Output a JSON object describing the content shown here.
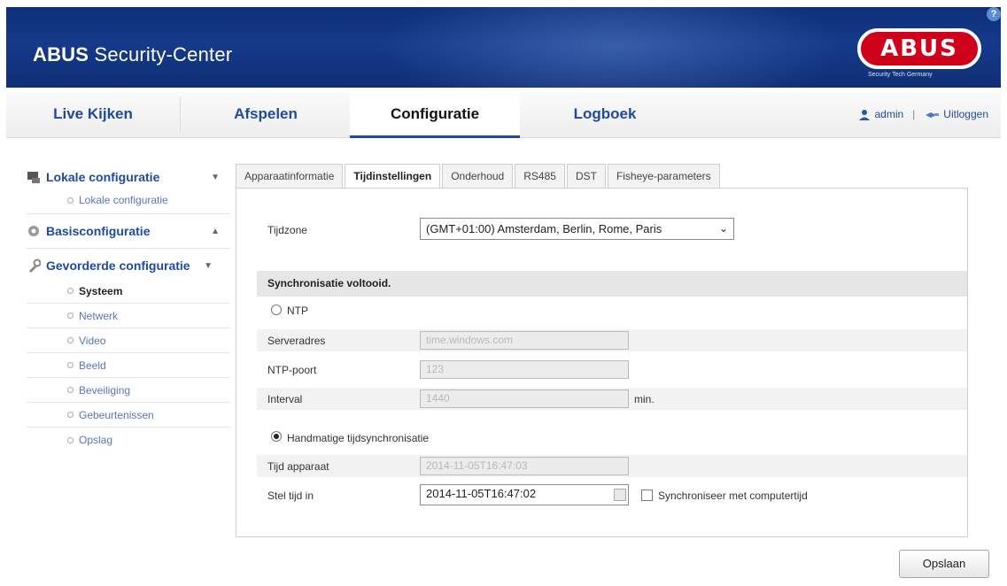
{
  "header": {
    "title_bold": "ABUS",
    "title_rest": " Security-Center",
    "logo_text": "ABUS",
    "logo_tagline": "Security Tech Germany",
    "help_label": "?"
  },
  "nav": {
    "tabs": [
      {
        "label": "Live Kijken"
      },
      {
        "label": "Afspelen"
      },
      {
        "label": "Configuratie"
      },
      {
        "label": "Logboek"
      }
    ],
    "user": "admin",
    "separator": "|",
    "logout": "Uitloggen"
  },
  "sidebar": {
    "local": {
      "label": "Lokale configuratie",
      "items": [
        "Lokale configuratie"
      ]
    },
    "basic": {
      "label": "Basisconfiguratie"
    },
    "advanced": {
      "label": "Gevorderde configuratie",
      "items": [
        "Systeem",
        "Netwerk",
        "Video",
        "Beeld",
        "Beveiliging",
        "Gebeurtenissen",
        "Opslag"
      ]
    }
  },
  "tabs": [
    "Apparaatinformatie",
    "Tijdinstellingen",
    "Onderhoud",
    "RS485",
    "DST",
    "Fisheye-parameters"
  ],
  "form": {
    "timezone_label": "Tijdzone",
    "timezone_value": "(GMT+01:00) Amsterdam, Berlin, Rome, Paris",
    "sync_status": "Synchronisatie voltooid.",
    "ntp_label": "NTP",
    "server_label": "Serveradres",
    "server_value": "time.windows.com",
    "port_label": "NTP-poort",
    "port_value": "123",
    "interval_label": "Interval",
    "interval_value": "1440",
    "interval_unit": "min.",
    "manual_label": "Handmatige tijdsynchronisatie",
    "device_time_label": "Tijd apparaat",
    "device_time_value": "2014-11-05T16:47:03",
    "set_time_label": "Stel tijd in",
    "set_time_value": "2014-11-05T16:47:02",
    "sync_computer_label": "Synchroniseer met computertijd"
  },
  "save_label": "Opslaan",
  "colors": {
    "header_blue": "#163a8a",
    "link_blue": "#1f4aa0",
    "logo_red": "#d0021b"
  }
}
